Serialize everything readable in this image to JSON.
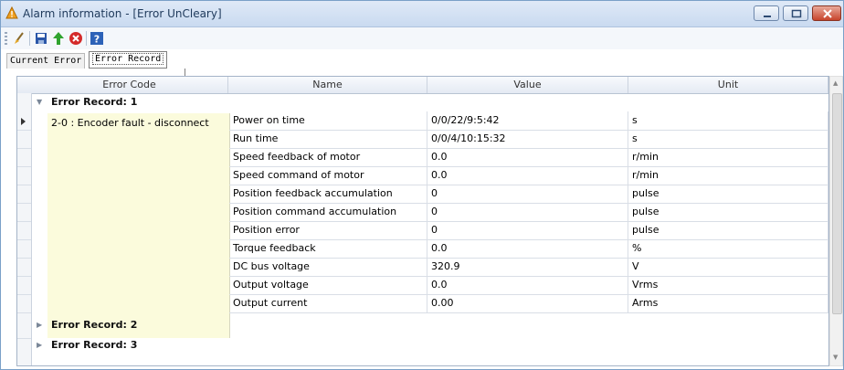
{
  "window": {
    "title": "Alarm information - [Error UnCleary]"
  },
  "toolbar": {
    "items": [
      "brush-icon",
      "save-icon",
      "upload-icon",
      "delete-icon",
      "help-icon"
    ]
  },
  "tabs": [
    {
      "label": "Current Error"
    },
    {
      "label": "Error Record"
    }
  ],
  "grid": {
    "columns": [
      "Error Code",
      "Name",
      "Value",
      "Unit"
    ],
    "groups": [
      {
        "label": "Error Record: 1",
        "expanded": true,
        "error_code": "2-0 : Encoder fault - disconnect",
        "rows": [
          {
            "name": "Power on time",
            "value": "0/0/22/9:5:42",
            "unit": "s"
          },
          {
            "name": "Run time",
            "value": "0/0/4/10:15:32",
            "unit": "s"
          },
          {
            "name": "Speed feedback of motor",
            "value": "0.0",
            "unit": "r/min"
          },
          {
            "name": "Speed command of motor",
            "value": "0.0",
            "unit": "r/min"
          },
          {
            "name": "Position feedback accumulation",
            "value": "0",
            "unit": "pulse"
          },
          {
            "name": "Position command accumulation",
            "value": "0",
            "unit": "pulse"
          },
          {
            "name": "Position error",
            "value": "0",
            "unit": "pulse"
          },
          {
            "name": "Torque feedback",
            "value": "0.0",
            "unit": "%"
          },
          {
            "name": "DC bus voltage",
            "value": "320.9",
            "unit": "V"
          },
          {
            "name": "Output voltage",
            "value": "0.0",
            "unit": "Vrms"
          },
          {
            "name": "Output current",
            "value": "0.00",
            "unit": "Arms"
          }
        ]
      },
      {
        "label": "Error Record: 2",
        "expanded": false
      },
      {
        "label": "Error Record: 3",
        "expanded": false
      }
    ]
  },
  "colors": {
    "error_code_bg": "#fbfbdc",
    "accent": "#1e395b"
  }
}
